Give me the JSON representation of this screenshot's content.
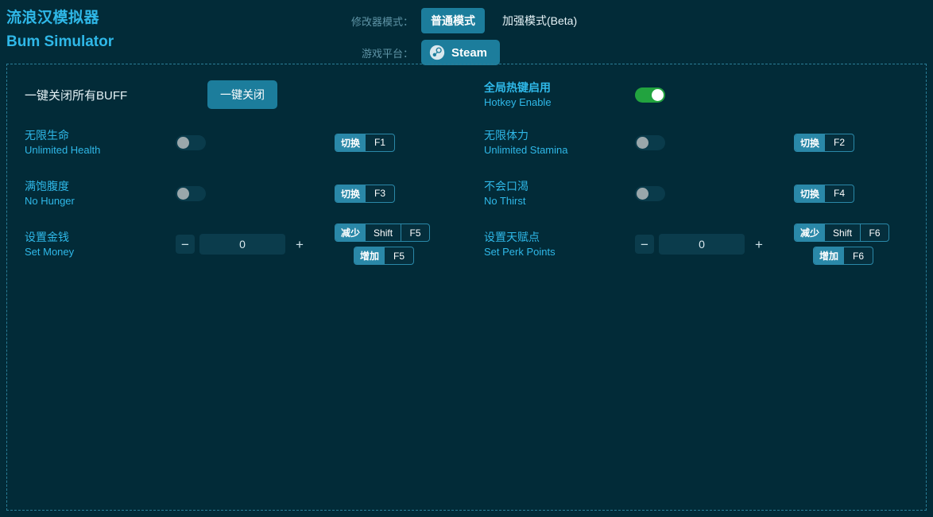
{
  "header": {
    "title_cn": "流浪汉模拟器",
    "title_en": "Bum Simulator",
    "mode_label": "修改器模式：",
    "mode_normal": "普通模式",
    "mode_enhanced": "加强模式(Beta)",
    "platform_label": "游戏平台：",
    "platform_value": "Steam",
    "platform_icon": "steam-icon"
  },
  "buff_off": {
    "label": "一键关闭所有BUFF",
    "button": "一键关闭"
  },
  "hotkey_enable": {
    "label_cn": "全局热键启用",
    "label_en": "Hotkey Enable",
    "state": "on"
  },
  "rows": [
    {
      "cn": "无限生命",
      "en": "Unlimited Health",
      "type": "toggle",
      "state": "off",
      "hotkeys": [
        {
          "action": "切换",
          "keys": [
            "F1"
          ]
        }
      ]
    },
    {
      "cn": "无限体力",
      "en": "Unlimited Stamina",
      "type": "toggle",
      "state": "off",
      "hotkeys": [
        {
          "action": "切换",
          "keys": [
            "F2"
          ]
        }
      ]
    },
    {
      "cn": "满饱腹度",
      "en": "No Hunger",
      "type": "toggle",
      "state": "off",
      "hotkeys": [
        {
          "action": "切换",
          "keys": [
            "F3"
          ]
        }
      ]
    },
    {
      "cn": "不会口渴",
      "en": "No Thirst",
      "type": "toggle",
      "state": "off",
      "hotkeys": [
        {
          "action": "切换",
          "keys": [
            "F4"
          ]
        }
      ]
    },
    {
      "cn": "设置金钱",
      "en": "Set Money",
      "type": "stepper",
      "value": "0",
      "minus": "−",
      "plus": "+",
      "hotkeys": [
        {
          "action": "减少",
          "keys": [
            "Shift",
            "F5"
          ]
        },
        {
          "action": "增加",
          "keys": [
            "F5"
          ]
        }
      ]
    },
    {
      "cn": "设置天赋点",
      "en": "Set Perk Points",
      "type": "stepper",
      "value": "0",
      "minus": "−",
      "plus": "+",
      "hotkeys": [
        {
          "action": "减少",
          "keys": [
            "Shift",
            "F6"
          ]
        },
        {
          "action": "增加",
          "keys": [
            "F6"
          ]
        }
      ]
    }
  ],
  "colors": {
    "background": "#022b38",
    "accent": "#2fb8e8",
    "button": "#1c7d9c",
    "toggle_on": "#22a33f",
    "border_dash": "#2a7d96"
  }
}
